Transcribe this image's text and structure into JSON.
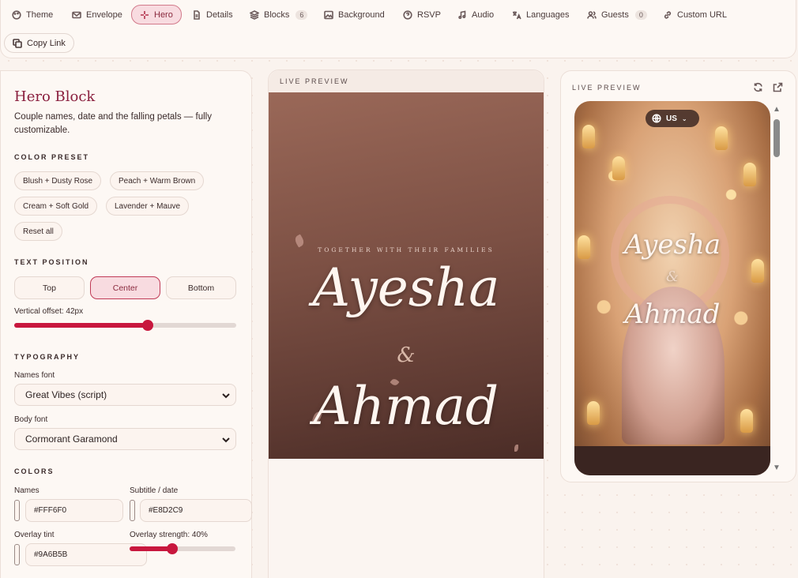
{
  "tabs": [
    {
      "label": "Theme",
      "icon": "palette-icon"
    },
    {
      "label": "Envelope",
      "icon": "envelope-icon"
    },
    {
      "label": "Hero",
      "icon": "sparkle-icon",
      "active": true
    },
    {
      "label": "Details",
      "icon": "document-icon"
    },
    {
      "label": "Blocks",
      "icon": "layers-icon",
      "badge": "6"
    },
    {
      "label": "Background",
      "icon": "image-icon"
    },
    {
      "label": "RSVP",
      "icon": "question-icon"
    },
    {
      "label": "Audio",
      "icon": "music-icon"
    },
    {
      "label": "Languages",
      "icon": "translate-icon"
    },
    {
      "label": "Guests",
      "icon": "users-icon",
      "badge": "0"
    },
    {
      "label": "Custom URL",
      "icon": "link-icon"
    }
  ],
  "copy_link": "Copy Link",
  "panel": {
    "title": "Hero Block",
    "description": "Couple names, date and the falling petals — fully customizable.",
    "color_preset_title": "COLOR PRESET",
    "presets": [
      "Blush + Dusty Rose",
      "Peach + Warm Brown",
      "Cream + Soft Gold",
      "Lavender + Mauve",
      "Reset all"
    ],
    "text_position_title": "TEXT POSITION",
    "positions": [
      "Top",
      "Center",
      "Bottom"
    ],
    "active_position": "Center",
    "vertical_offset_label": "Vertical offset: 42px",
    "vertical_offset_fraction": 0.6,
    "typography_title": "TYPOGRAPHY",
    "names_font_label": "Names font",
    "names_font_value": "Great Vibes (script)",
    "body_font_label": "Body font",
    "body_font_value": "Cormorant Garamond",
    "colors_title": "COLORS",
    "names_color_label": "Names",
    "names_color_value": "#FFF6F0",
    "subtitle_color_label": "Subtitle / date",
    "subtitle_color_value": "#E8D2C9",
    "overlay_tint_label": "Overlay tint",
    "overlay_tint_value": "#9A6B5B",
    "overlay_strength_label": "Overlay strength: 40%",
    "overlay_strength_fraction": 0.4
  },
  "preview": {
    "label": "LIVE PREVIEW",
    "subtitle": "TOGETHER WITH THEIR FAMILIES",
    "name1": "Ayesha",
    "amp": "&",
    "name2": "Ahmad"
  },
  "live_preview": {
    "label": "LIVE PREVIEW",
    "lang": "US",
    "name1": "Ayesha",
    "amp": "&",
    "name2": "Ahmad"
  },
  "colors": {
    "accent": "#C8173E",
    "names": "#FFF6F0",
    "subtitle": "#E8D2C9",
    "overlay": "#9A6B5B"
  }
}
